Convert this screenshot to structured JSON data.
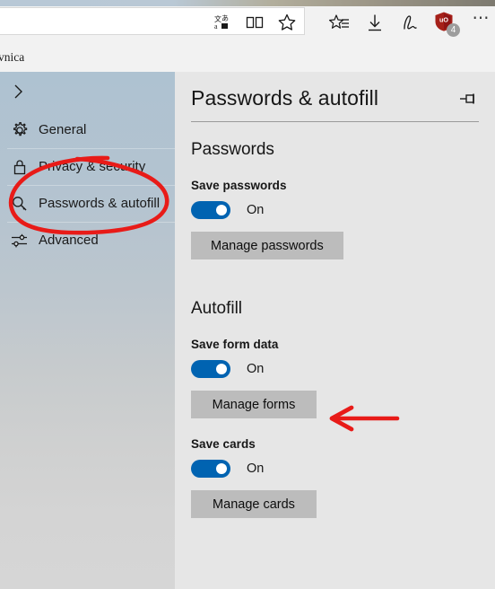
{
  "browser": {
    "page_text_fragment": "vnica",
    "address_bar": {
      "value": "",
      "placeholder": ""
    },
    "address_icons": [
      {
        "name": "translate-icon",
        "label": "Translate"
      },
      {
        "name": "reading-view-icon",
        "label": "Reading view"
      },
      {
        "name": "favorites-star-icon",
        "label": "Add to favorites or reading list"
      }
    ],
    "toolbar_icons": [
      {
        "name": "hub-favorites-icon",
        "label": "Hub (favorites, reading list, history and downloads)"
      },
      {
        "name": "downloads-icon",
        "label": "Downloads"
      },
      {
        "name": "make-a-note-icon",
        "label": "Make a Web Note"
      },
      {
        "name": "ublock-origin-icon",
        "label": "uBlock Origin",
        "badge": "4",
        "shield_color": "#a52019",
        "badge_color": "#9d9d9d"
      },
      {
        "name": "more-icon",
        "label": "Settings and more"
      }
    ]
  },
  "settings": {
    "back_label": "",
    "sidebar": [
      {
        "label": "General",
        "icon": "gear-icon",
        "selected": false
      },
      {
        "label": "Privacy & security",
        "icon": "lock-icon",
        "selected": false
      },
      {
        "label": "Passwords & autofill",
        "icon": "key-icon",
        "selected": true
      },
      {
        "label": "Advanced",
        "icon": "sliders-icon",
        "selected": false
      }
    ],
    "title": "Passwords & autofill",
    "pin_icon": "pin-icon",
    "sections": [
      {
        "heading": "Passwords",
        "settings": [
          {
            "label": "Save passwords",
            "toggle_state": "On",
            "toggle_on": true,
            "button": "Manage passwords"
          }
        ]
      },
      {
        "heading": "Autofill",
        "settings": [
          {
            "label": "Save form data",
            "toggle_state": "On",
            "toggle_on": true,
            "button": "Manage forms"
          },
          {
            "label": "Save cards",
            "toggle_state": "On",
            "toggle_on": true,
            "button": "Manage cards"
          }
        ]
      }
    ]
  },
  "annotations": {
    "circle_target": "Passwords & autofill",
    "arrow_target": "Manage forms",
    "color": "#e81b18"
  }
}
